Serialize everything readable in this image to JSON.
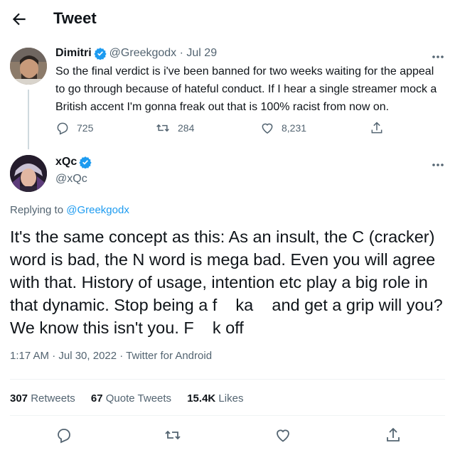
{
  "header": {
    "title": "Tweet"
  },
  "parent_tweet": {
    "display_name": "Dimitri",
    "handle_date": "@Greekgodx · Jul 29",
    "text": "So the final verdict is i've been banned for two weeks waiting for the appeal to go through because of hateful conduct. If I hear a single streamer mock a British accent I'm gonna freak out that is 100% racist from now on.",
    "replies": "725",
    "retweets": "284",
    "likes": "8,231"
  },
  "main_tweet": {
    "display_name": "xQc",
    "handle": "@xQc",
    "replying_prefix": "Replying to",
    "replying_to": "@Greekgodx",
    "text": "It's the same concept as this: As an insult, the C (cracker) word is bad, the N word is mega bad. Even you will agree with that. History of usage, intention etc play a big role in that dynamic. Stop being a f    ka    and get a grip will you? We know this isn't you. F    k off",
    "timestamp": "1:17 AM · Jul 30, 2022 · Twitter for Android",
    "retweets_count": "307",
    "retweets_label": "Retweets",
    "quote_count": "67",
    "quote_label": "Quote Tweets",
    "likes_count": "15.4K",
    "likes_label": "Likes"
  },
  "colors": {
    "accent": "#1d9bf0",
    "text_primary": "#0f1419",
    "text_secondary": "#536471",
    "divider": "#eff3f4"
  },
  "icons": [
    "back-arrow-icon",
    "verified-badge-icon",
    "more-icon",
    "reply-icon",
    "retweet-icon",
    "like-icon",
    "share-icon"
  ]
}
